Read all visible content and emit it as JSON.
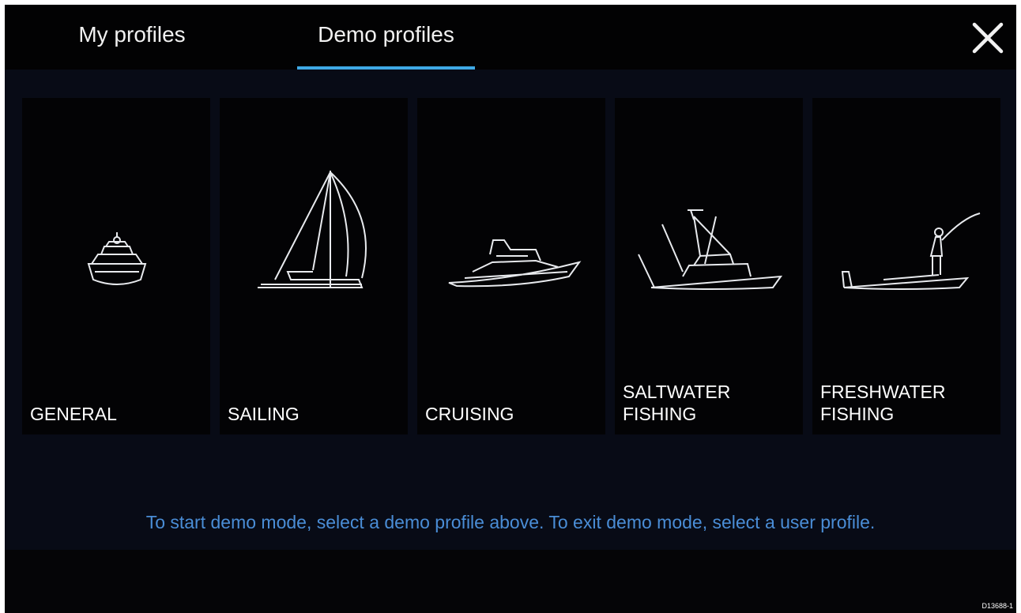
{
  "tabs": [
    {
      "label": "My profiles",
      "selected": false
    },
    {
      "label": "Demo profiles",
      "selected": true
    }
  ],
  "close_icon": "close-icon",
  "accent_color": "#3fa9e6",
  "hint_color": "#4a8dd6",
  "profiles": [
    {
      "label": "GENERAL",
      "icon": "motorboat-front-icon"
    },
    {
      "label": "SAILING",
      "icon": "sailboat-icon"
    },
    {
      "label": "CRUISING",
      "icon": "cruiser-icon"
    },
    {
      "label": "SALTWATER\nFISHING",
      "icon": "sportfisher-icon"
    },
    {
      "label": "FRESHWATER\nFISHING",
      "icon": "bass-boat-icon"
    }
  ],
  "hint": "To start demo mode, select a demo profile above. To exit demo mode, select a user profile.",
  "doc_id": "D13688-1"
}
